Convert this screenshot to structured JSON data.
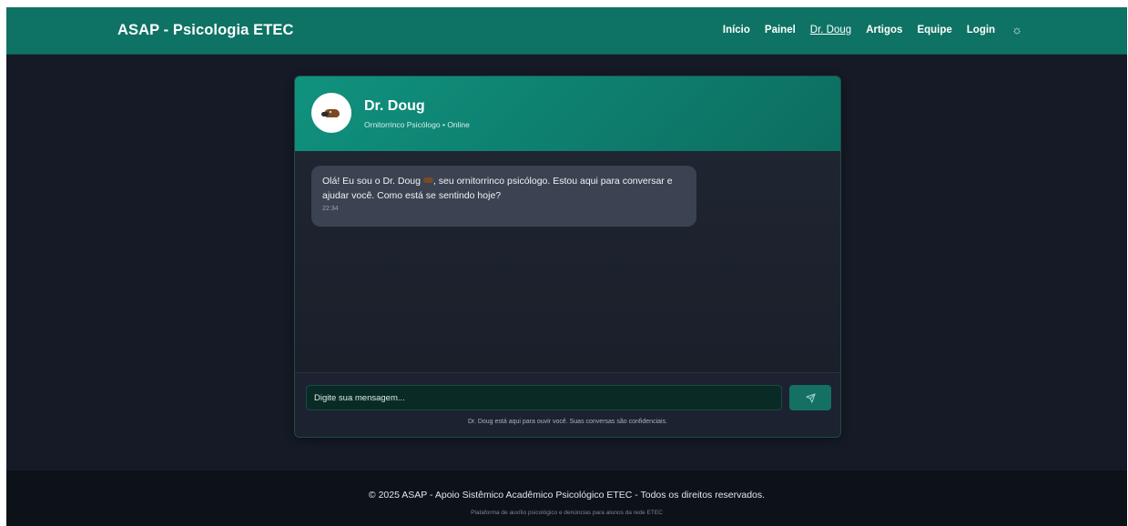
{
  "navbar": {
    "brand": "ASAP - Psicologia ETEC",
    "links": [
      "Início",
      "Painel",
      "Dr. Doug",
      "Artigos",
      "Equipe",
      "Login"
    ],
    "active_link": "Dr. Doug",
    "theme_icon": "sun-icon"
  },
  "chat": {
    "header": {
      "name": "Dr. Doug",
      "subtitle": "Ornitorrinco Psicólogo • Online",
      "avatar_icon": "platypus-icon"
    },
    "messages": [
      {
        "text_before_emoji": "Olá! Eu sou o Dr. Doug ",
        "text_after_emoji": ", seu ornitorrinco psicólogo. Estou aqui para conversar e ajudar você. Como está se sentindo hoje?",
        "time": "22:34"
      }
    ],
    "input": {
      "placeholder": "Digite sua mensagem...",
      "value": ""
    },
    "send_icon": "send-icon",
    "disclaimer": "Dr. Doug está aqui para ouvir você. Suas conversas são confidenciais."
  },
  "footer": {
    "copyright": "© 2025 ASAP - Apoio Sistêmico Acadêmico Psicológico ETEC - Todos os direitos reservados.",
    "tagline": "Plataforma de auxílio psicológico e denúncias para alunos da rede ETEC"
  },
  "colors": {
    "primary": "#0e7264",
    "background": "#151a26",
    "bubble": "#3b4352"
  }
}
